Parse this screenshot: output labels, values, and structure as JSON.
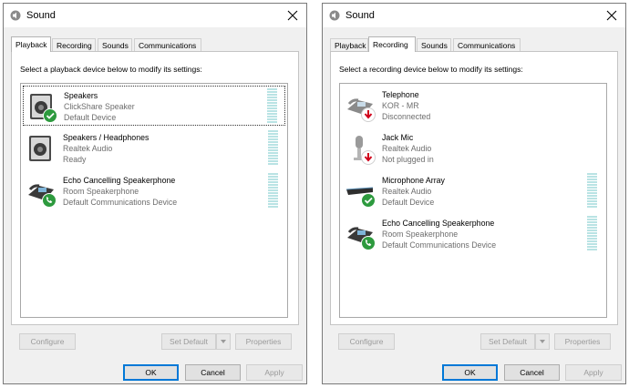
{
  "windows": [
    {
      "id": "playback",
      "title": "Sound",
      "tabs": [
        "Playback",
        "Recording",
        "Sounds",
        "Communications"
      ],
      "active_tab": 0,
      "instruction": "Select a playback device below to modify its settings:",
      "devices": [
        {
          "name": "Speakers",
          "sub": "ClickShare Speaker",
          "status": "Default Device",
          "icon": "speaker-icon",
          "badge": "check",
          "selected": true,
          "meter": true
        },
        {
          "name": "Speakers / Headphones",
          "sub": "Realtek Audio",
          "status": "Ready",
          "icon": "speaker-icon",
          "badge": "none",
          "selected": false,
          "meter": true
        },
        {
          "name": "Echo Cancelling Speakerphone",
          "sub": "Room Speakerphone",
          "status": "Default Communications Device",
          "icon": "phone-icon",
          "badge": "phone",
          "selected": false,
          "meter": true
        }
      ],
      "buttons": {
        "configure": "Configure",
        "set_default": "Set Default",
        "properties": "Properties",
        "ok": "OK",
        "cancel": "Cancel",
        "apply": "Apply"
      }
    },
    {
      "id": "recording",
      "title": "Sound",
      "tabs": [
        "Playback",
        "Recording",
        "Sounds",
        "Communications"
      ],
      "active_tab": 1,
      "instruction": "Select a recording device below to modify its settings:",
      "devices": [
        {
          "name": "Telephone",
          "sub": "KOR - MR",
          "status": "Disconnected",
          "icon": "phone-icon",
          "badge": "down",
          "selected": false,
          "meter": false
        },
        {
          "name": "Jack Mic",
          "sub": "Realtek Audio",
          "status": "Not plugged in",
          "icon": "microphone-icon",
          "badge": "down",
          "selected": false,
          "meter": false
        },
        {
          "name": "Microphone Array",
          "sub": "Realtek Audio",
          "status": "Default Device",
          "icon": "mic-array-icon",
          "badge": "check",
          "selected": false,
          "meter": true
        },
        {
          "name": "Echo Cancelling Speakerphone",
          "sub": "Room Speakerphone",
          "status": "Default Communications Device",
          "icon": "phone-icon",
          "badge": "phone",
          "selected": false,
          "meter": true
        }
      ],
      "buttons": {
        "configure": "Configure",
        "set_default": "Set Default",
        "properties": "Properties",
        "ok": "OK",
        "cancel": "Cancel",
        "apply": "Apply"
      }
    }
  ],
  "colors": {
    "accent": "#0078d7",
    "success": "#2d9a3e",
    "error": "#d0021b",
    "meter": "#b9e3e4"
  }
}
